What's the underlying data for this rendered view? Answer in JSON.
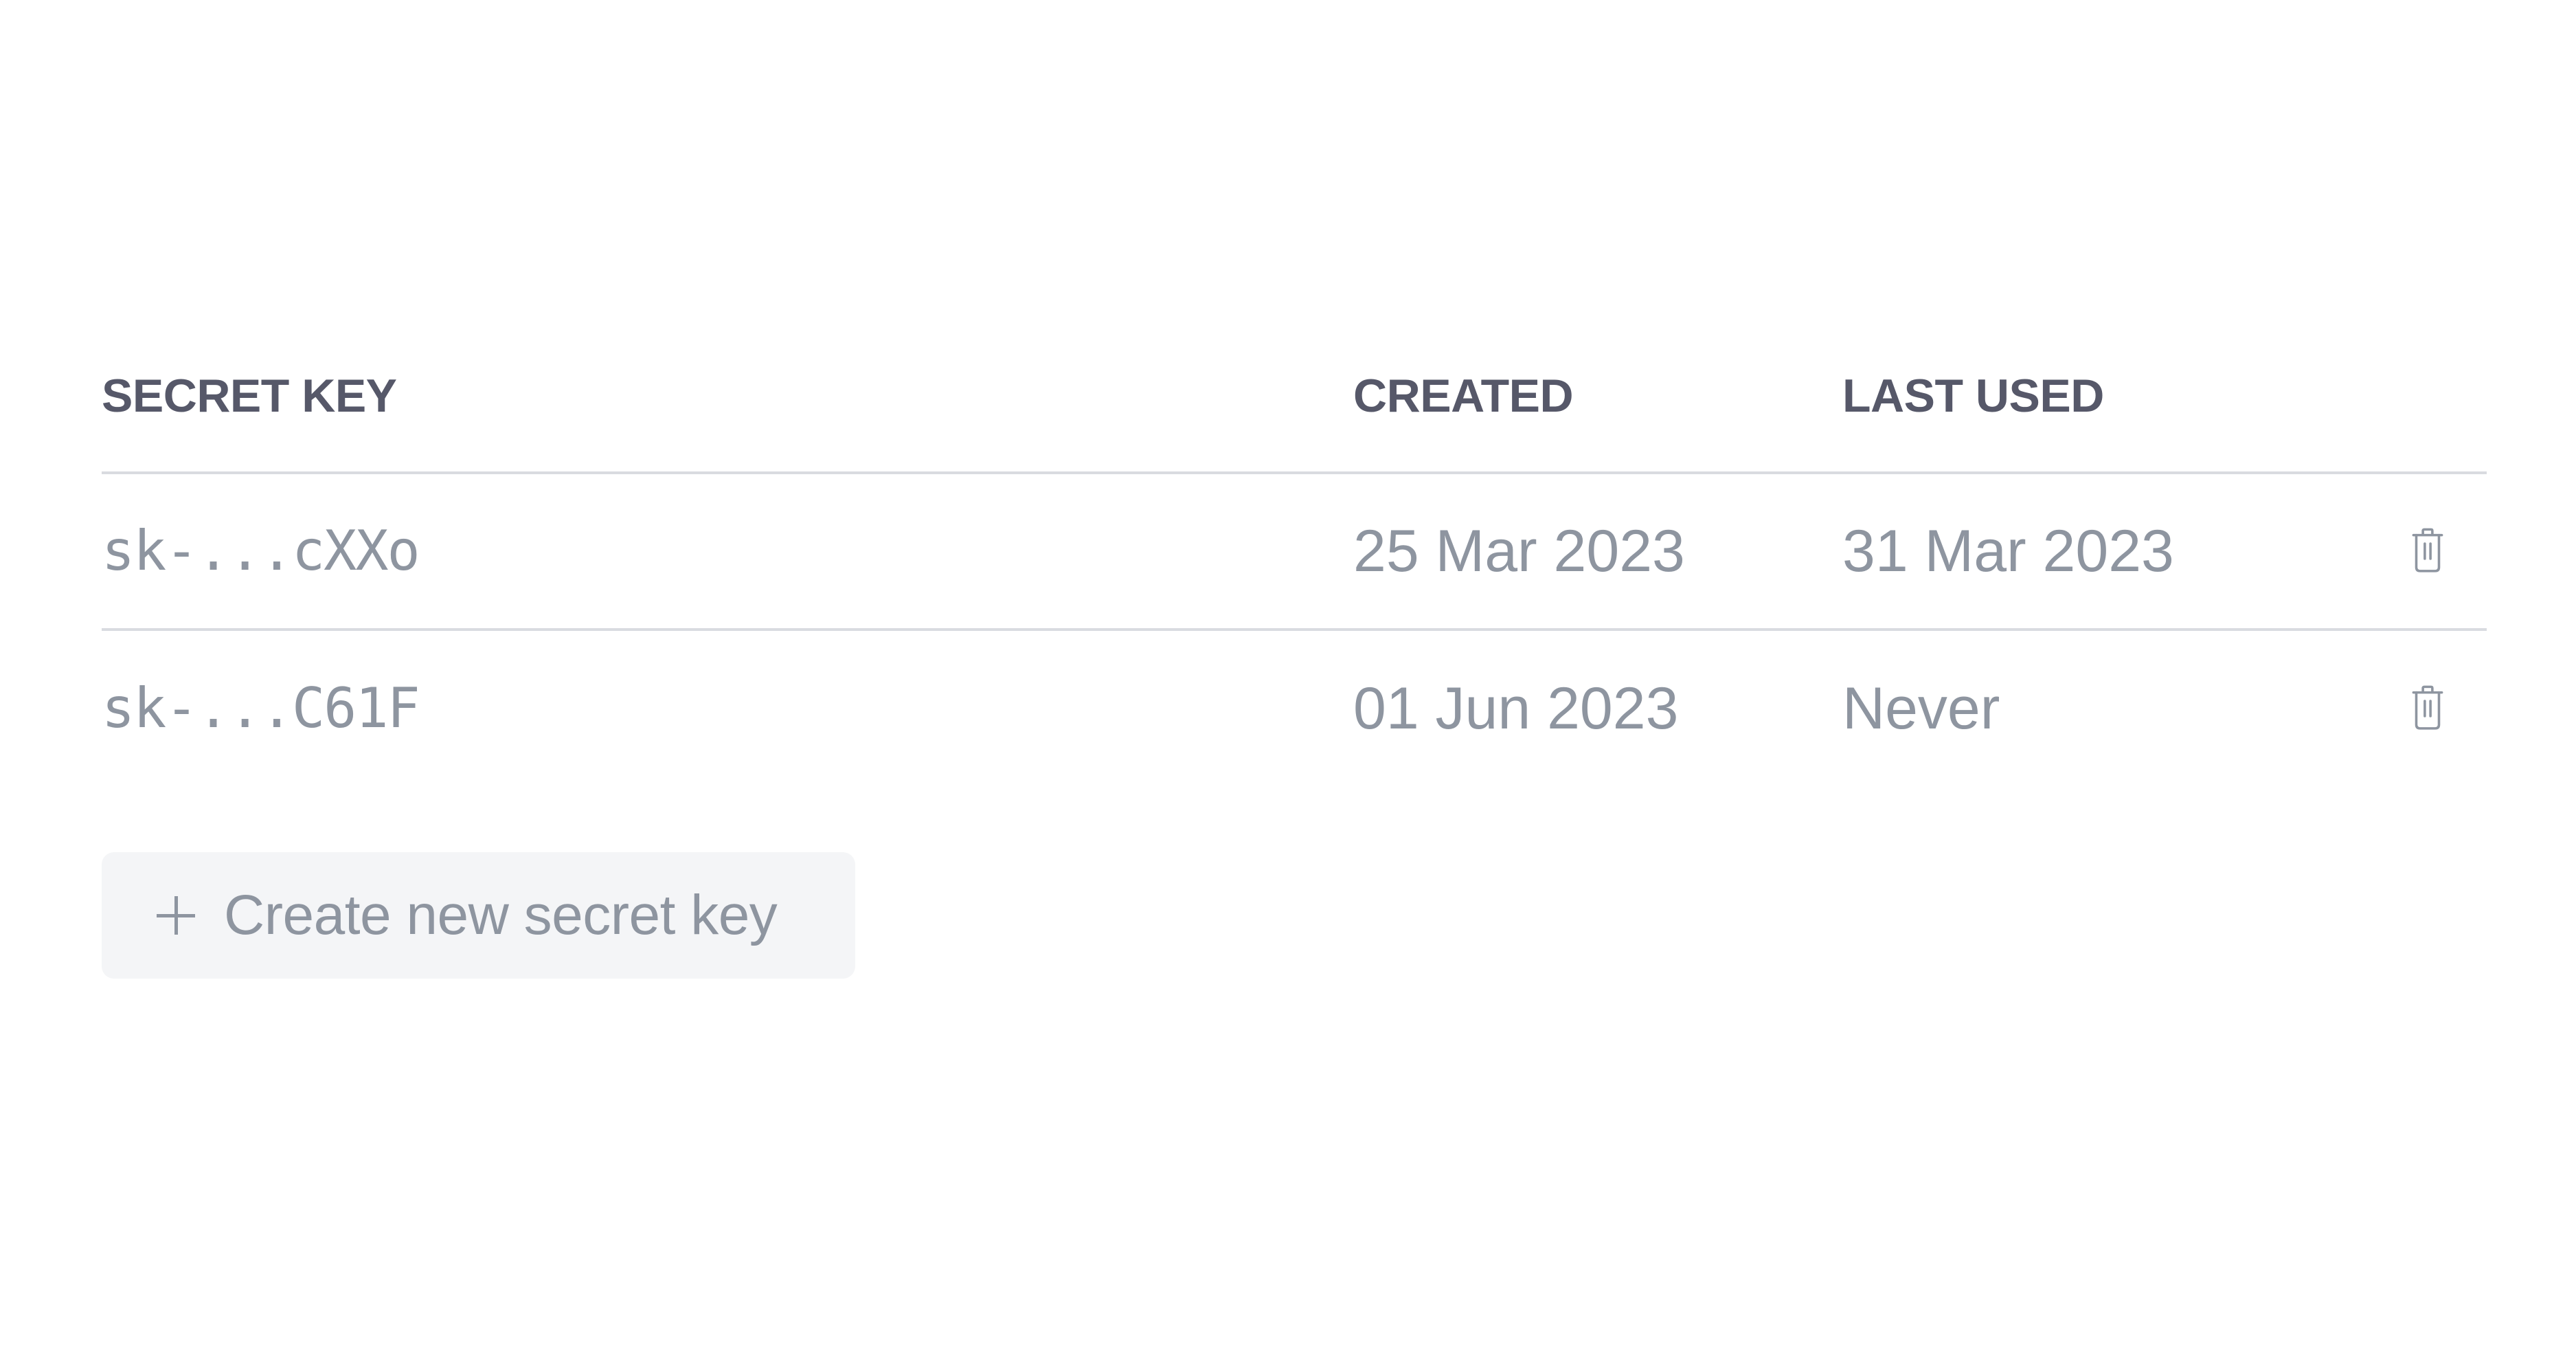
{
  "table": {
    "columns": {
      "secret_key": "SECRET KEY",
      "created": "CREATED",
      "last_used": "LAST USED"
    },
    "rows": [
      {
        "secret_key": "sk-...cXXo",
        "created": "25 Mar 2023",
        "last_used": "31 Mar 2023",
        "action_icon": "trash-icon"
      },
      {
        "secret_key": "sk-...C61F",
        "created": "01 Jun 2023",
        "last_used": "Never",
        "action_icon": "trash-icon"
      }
    ]
  },
  "create_button": {
    "icon": "plus-icon",
    "label": "Create new secret key"
  },
  "colors": {
    "header_text": "#565869",
    "body_text": "#8e95a0",
    "divider": "#d9dbe0",
    "button_bg": "#f4f5f7"
  }
}
